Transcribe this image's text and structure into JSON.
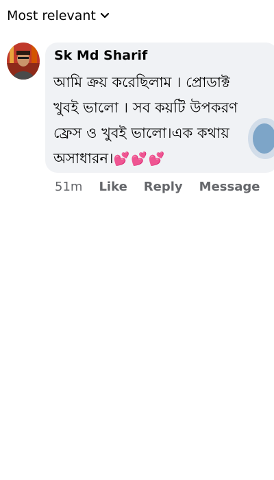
{
  "sort": {
    "label": "Most relevant"
  },
  "comment": {
    "author": "Sk Md Sharif",
    "text": "আমি ক্রয় করেছিলাম । প্রোডাক্ট খুবই ভালো । সব কয়টি উপকরণ ফ্রেস ও খুবই ভালো।এক কথায় অসাধারন।",
    "emoji": "💕💕💕",
    "time": "51m",
    "like_label": "Like",
    "reply_label": "Reply",
    "message_label": "Message"
  },
  "colors": {
    "bubble": "#f0f2f5",
    "meta_text": "#65676b",
    "heart": "#e0245e"
  }
}
